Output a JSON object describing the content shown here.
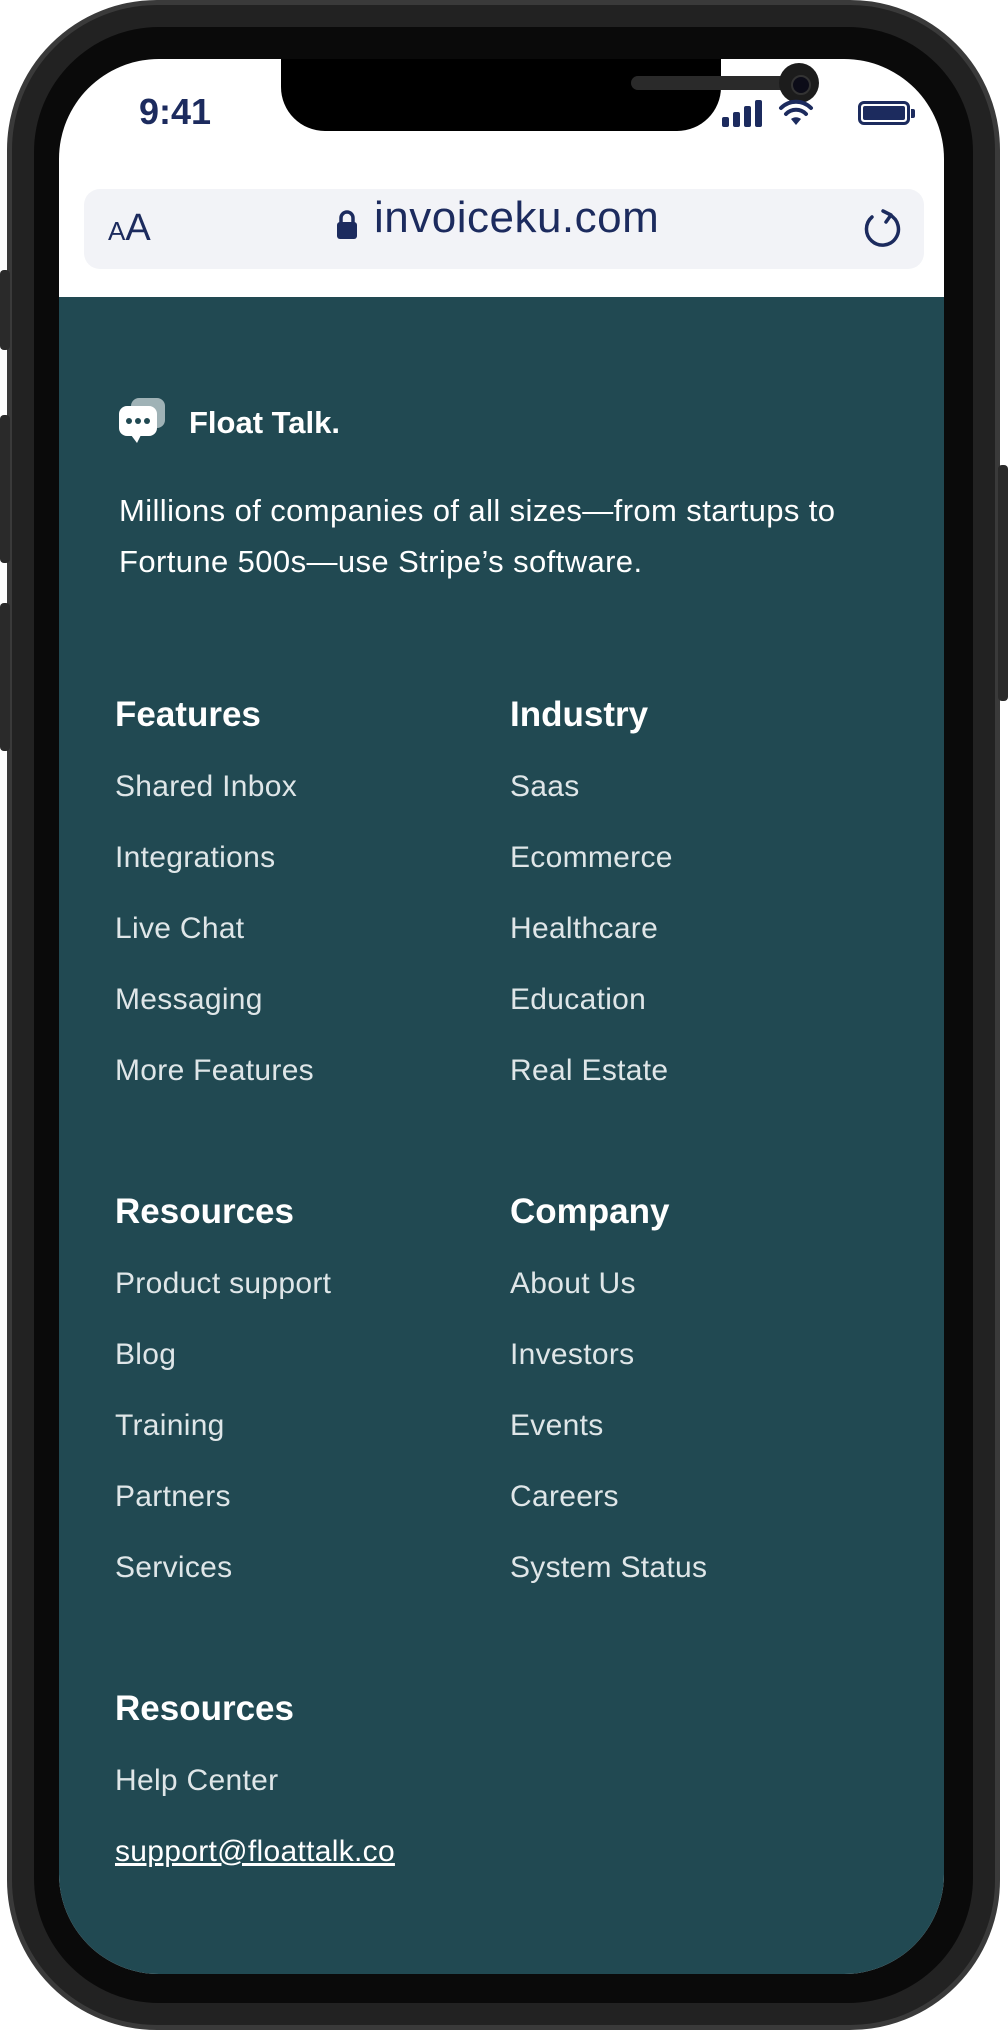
{
  "status_bar": {
    "time": "9:41"
  },
  "browser": {
    "text_size_small": "A",
    "text_size_big": "A",
    "url": "invoiceku.com"
  },
  "footer": {
    "brand_name": "Float Talk.",
    "tagline": "Millions of companies of all sizes—from startups to Fortune 500s—use Stripe’s software.",
    "columns": [
      {
        "title": "Features",
        "links": [
          "Shared Inbox",
          "Integrations",
          "Live Chat",
          "Messaging",
          "More Features"
        ]
      },
      {
        "title": "Industry",
        "links": [
          "Saas",
          "Ecommerce",
          "Healthcare",
          "Education",
          "Real Estate"
        ]
      },
      {
        "title": "Resources",
        "links": [
          "Product support",
          "Blog",
          "Training",
          "Partners",
          "Services"
        ]
      },
      {
        "title": "Company",
        "links": [
          "About Us",
          "Investors",
          "Events",
          "Careers",
          "System Status"
        ]
      },
      {
        "title": "Resources",
        "links": [
          "Help Center",
          "support@floattalk.co"
        ]
      }
    ]
  },
  "colors": {
    "footer_bg": "#214952",
    "status_text": "#1c2b5e",
    "url_bar_bg": "#f2f3f7"
  }
}
